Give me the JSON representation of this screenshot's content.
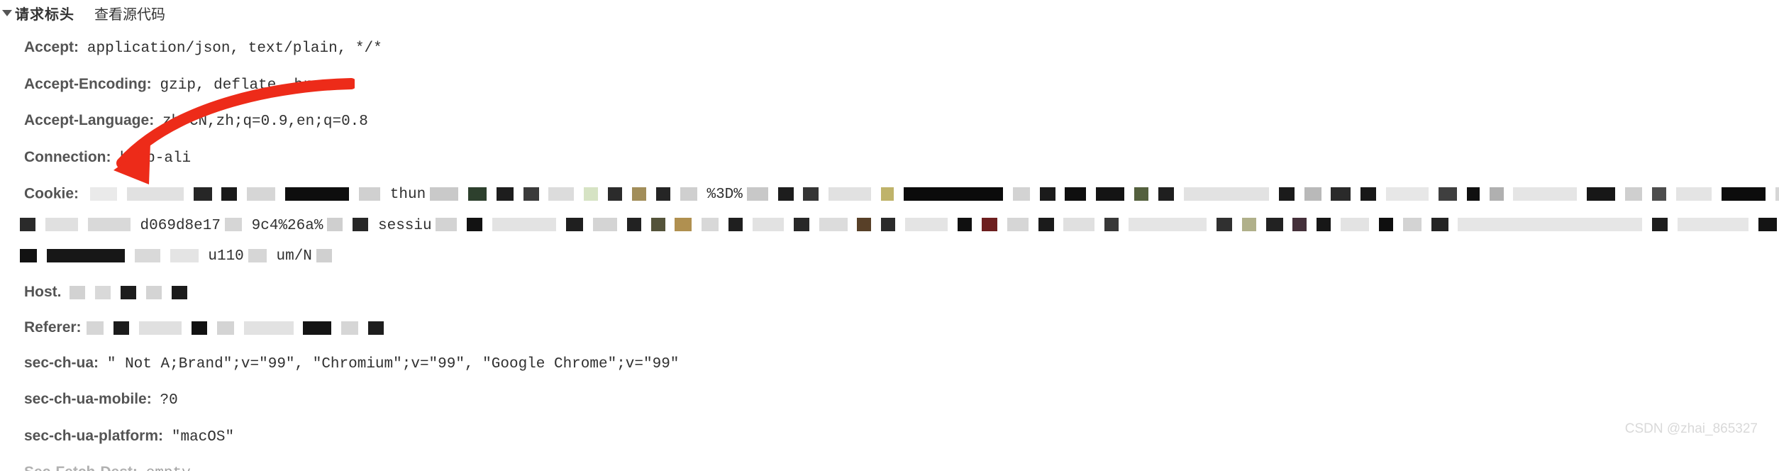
{
  "section": {
    "title": "请求标头",
    "viewSource": "查看源代码"
  },
  "headers": {
    "accept": {
      "name": "Accept:",
      "value": "application/json, text/plain, */*"
    },
    "acceptEncoding": {
      "name": "Accept-Encoding:",
      "value": "gzip, deflate, br"
    },
    "acceptLanguage": {
      "name": "Accept-Language:",
      "value": "zh-CN,zh;q=0.9,en;q=0.8"
    },
    "connection": {
      "name": "Connection:",
      "value": "keep-ali"
    },
    "cookie": {
      "name": "Cookie:",
      "frag1": "thun",
      "frag2": "%3D%",
      "frag3": "d069d8e17",
      "frag4": "9c4%26a%",
      "frag5": "sessiu",
      "frag6": "u110",
      "frag7": "um/N"
    },
    "host": {
      "name": "Host."
    },
    "referer": {
      "name": "Referer:"
    },
    "secChUa": {
      "name": "sec-ch-ua:",
      "value": "\" Not A;Brand\";v=\"99\", \"Chromium\";v=\"99\", \"Google Chrome\";v=\"99\""
    },
    "secChUaMobile": {
      "name": "sec-ch-ua-mobile:",
      "value": "?0"
    },
    "secChUaPlatform": {
      "name": "sec-ch-ua-platform:",
      "value": "\"macOS\""
    },
    "secFetchDest": {
      "name": "Sec-Fetch-Dest:",
      "value": "empty"
    }
  },
  "watermark": "CSDN @zhai_865327"
}
